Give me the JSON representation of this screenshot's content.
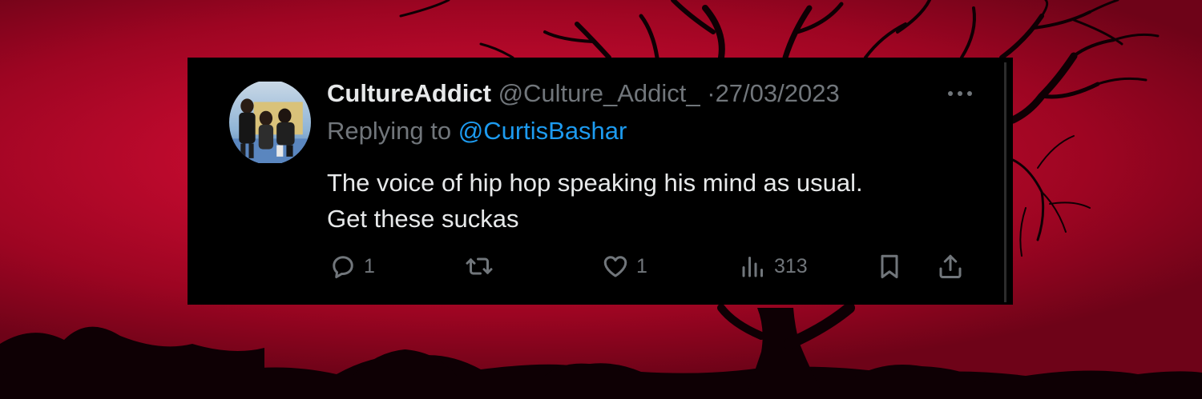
{
  "tweet": {
    "display_name": "CultureAddict",
    "handle": "@Culture_Addict_",
    "separator": "·",
    "date": "27/03/2023",
    "replying_prefix": "Replying to",
    "replying_to": "@CurtisBashar",
    "text_lines": [
      "The voice of hip hop speaking his mind as usual.",
      "Get these suckas"
    ],
    "actions": {
      "reply_count": "1",
      "like_count": "1",
      "views_count": "313"
    }
  },
  "icons": {
    "more": "ellipsis-icon",
    "reply": "speech-bubble-icon",
    "retweet": "retweet-arrows-icon",
    "like": "heart-icon",
    "views": "bar-chart-icon",
    "bookmark": "bookmark-icon",
    "share": "share-upload-icon"
  },
  "colors": {
    "card_background": "#000000",
    "primary_text": "#e7e9ea",
    "secondary_text": "#71767b",
    "mention_blue": "#1d9bf0",
    "sky_red": "#c00a2e"
  }
}
